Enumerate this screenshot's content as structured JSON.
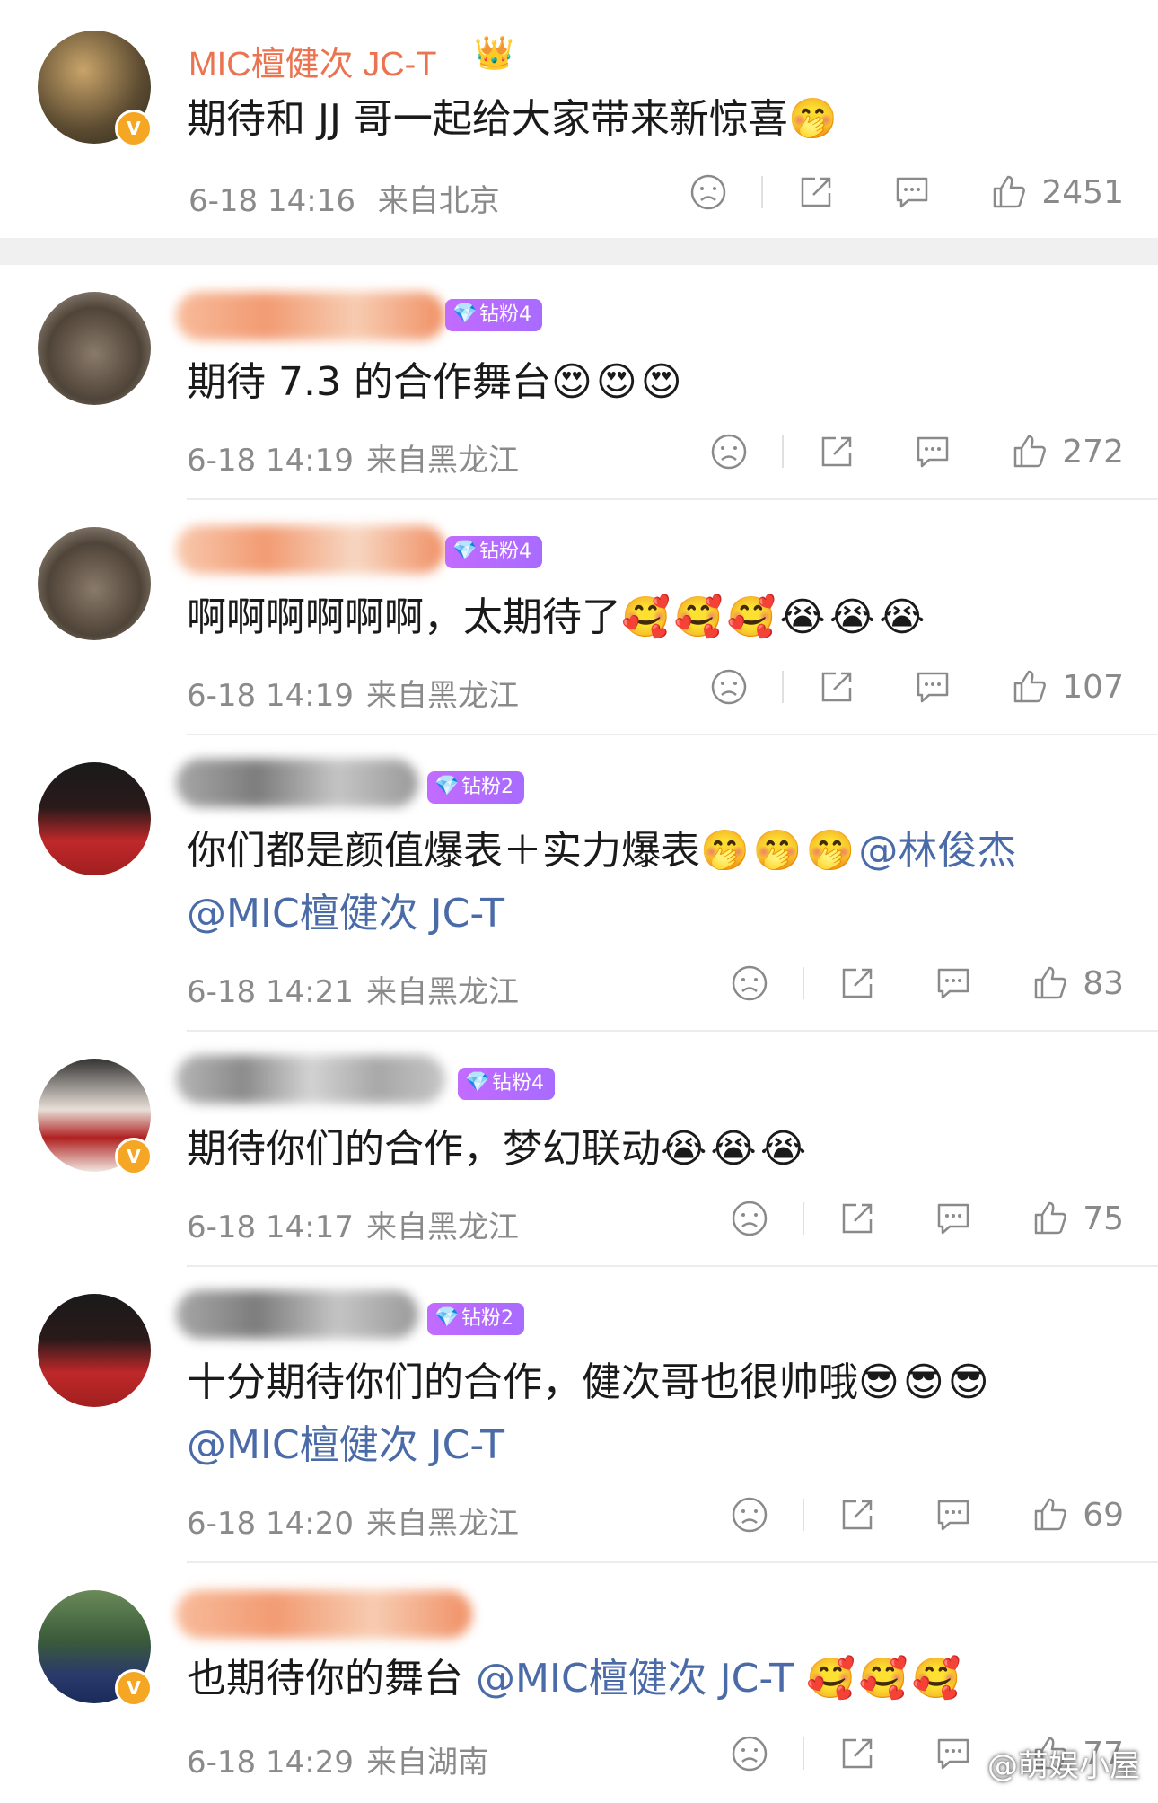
{
  "colors": {
    "username": "#eb7350",
    "mention": "#4a6ba8",
    "meta": "#8a8a8a",
    "badge": "#b46bff",
    "verified": "#f5a623"
  },
  "top_comment": {
    "username": "MIC檀健次 JC-T",
    "text": "期待和 JJ 哥一起给大家带来新惊喜",
    "emojis": "🤭",
    "time": "6-18 14:16",
    "location": "来自北京",
    "likes": "2451"
  },
  "replies": [
    {
      "badge": "钻粉4",
      "text": "期待 7.3 的合作舞台",
      "emojis": "😍😍😍",
      "time": "6-18 14:19",
      "location": "来自黑龙江",
      "likes": "272"
    },
    {
      "badge": "钻粉4",
      "text": "啊啊啊啊啊啊，太期待了",
      "emojis": "🥰🥰🥰😭😭😭",
      "time": "6-18 14:19",
      "location": "来自黑龙江",
      "likes": "107"
    },
    {
      "badge": "钻粉2",
      "text": "你们都是颜值爆表＋实力爆表",
      "emojis": "🤭🤭🤭",
      "mention1": "@林俊杰",
      "mention2": "@MIC檀健次 JC-T",
      "time": "6-18 14:21",
      "location": "来自黑龙江",
      "likes": "83"
    },
    {
      "badge": "钻粉4",
      "text": "期待你们的合作，梦幻联动",
      "emojis": "😭😭😭",
      "time": "6-18 14:17",
      "location": "来自黑龙江",
      "likes": "75"
    },
    {
      "badge": "钻粉2",
      "text": "十分期待你们的合作，健次哥也很帅哦",
      "emojis": "😎😎😎",
      "mention1": "@MIC檀健次 JC-T",
      "time": "6-18 14:20",
      "location": "来自黑龙江",
      "likes": "69"
    },
    {
      "text": "也期待你的舞台",
      "mention1": "@MIC檀健次 JC-T",
      "emojis": "🥰🥰🥰",
      "time": "6-18 14:29",
      "location": "来自湖南",
      "likes": "77"
    }
  ],
  "watermark": "@萌娱小屋"
}
